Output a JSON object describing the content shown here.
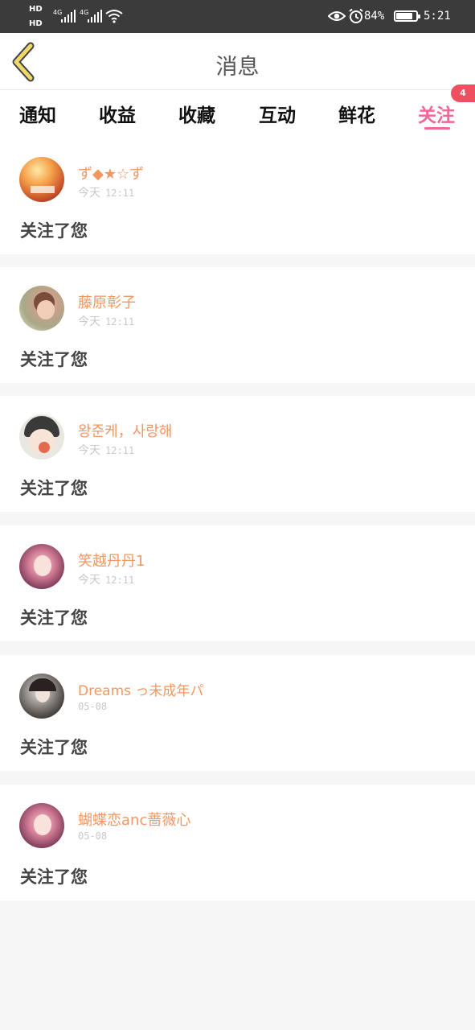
{
  "status_bar": {
    "hd1": "HD",
    "hd2": "HD",
    "net1": "4G",
    "net2": "4G",
    "battery_pct": "84%",
    "battery_level": 0.84,
    "time": "5:21"
  },
  "header": {
    "title": "消息"
  },
  "tabs": {
    "items": [
      {
        "label": "通知"
      },
      {
        "label": "收益"
      },
      {
        "label": "收藏"
      },
      {
        "label": "互动"
      },
      {
        "label": "鲜花"
      },
      {
        "label": "关注"
      }
    ],
    "active_index": 5,
    "badge_count": "4"
  },
  "messages": [
    {
      "name": "ず◆★☆ず",
      "day": "今天",
      "time": "12:11",
      "text": "关注了您"
    },
    {
      "name": "藤原彰子",
      "day": "今天",
      "time": "12:11",
      "text": "关注了您"
    },
    {
      "name": "왕준케，사랑해",
      "day": "今天",
      "time": "12:11",
      "text": "关注了您"
    },
    {
      "name": "笑越丹丹1",
      "day": "今天",
      "time": "12:11",
      "text": "关注了您"
    },
    {
      "name": "Dreams っ未成年パ",
      "day": "05-08",
      "time": "",
      "text": "关注了您"
    },
    {
      "name": "蝴蝶恋anc蔷薇心",
      "day": "05-08",
      "time": "",
      "text": "关注了您"
    }
  ],
  "colors": {
    "accent": "#f0679a",
    "username": "#f29761",
    "badge": "#ef4f61",
    "back_arrow": "#f0d96a"
  }
}
